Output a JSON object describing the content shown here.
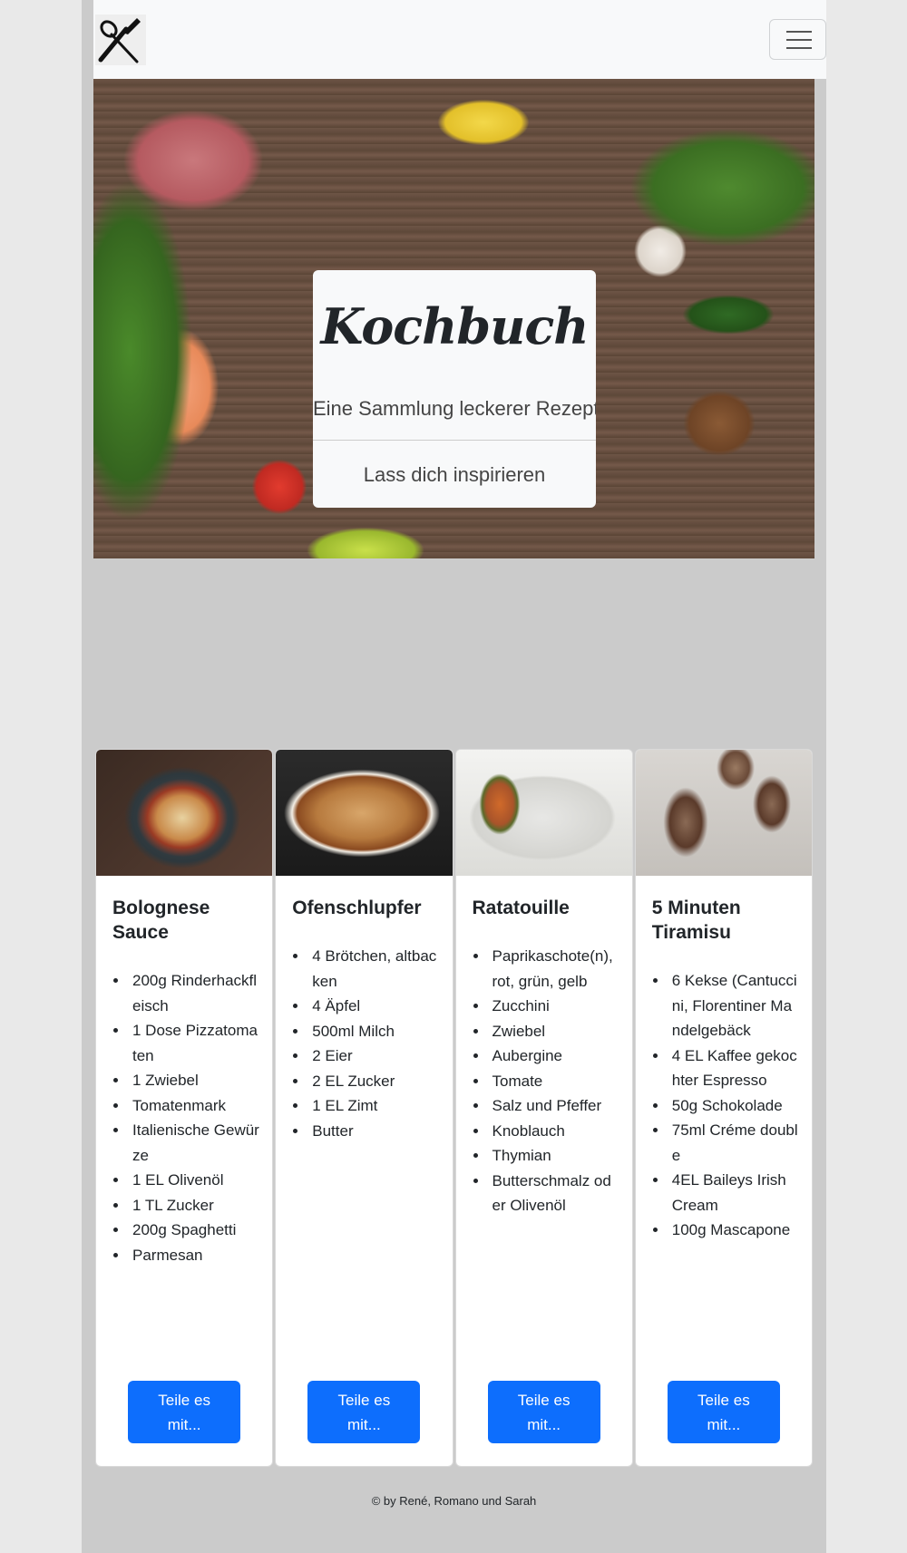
{
  "hero": {
    "title": "Kochbuch",
    "subtitle": "Eine Sammlung leckerer Rezepte",
    "cta": "Lass dich inspirieren"
  },
  "recipes": [
    {
      "title": "Bolognese Sauce",
      "ingredients": [
        "200g Rinderhackfleisch",
        "1 Dose Pizzatomaten",
        "1 Zwiebel",
        "Tomatenmark",
        "Italienische Gewürze",
        "1 EL Olivenöl",
        "1 TL Zucker",
        "200g Spaghetti",
        "Parmesan"
      ],
      "button": "Teile es mit..."
    },
    {
      "title": "Ofenschlupfer",
      "ingredients": [
        "4 Brötchen, altbacken",
        "4 Äpfel",
        "500ml Milch",
        "2 Eier",
        "2 EL Zucker",
        "1 EL Zimt",
        "Butter"
      ],
      "button": "Teile es mit..."
    },
    {
      "title": "Ratatouille",
      "ingredients": [
        "Paprikaschote(n), rot, grün, gelb",
        "Zucchini",
        "Zwiebel",
        "Aubergine",
        "Tomate",
        "Salz und Pfeffer",
        "Knoblauch",
        "Thymian",
        "Butterschmalz oder Olivenöl"
      ],
      "button": "Teile es mit..."
    },
    {
      "title": "5 Minuten Tiramisu",
      "ingredients": [
        "6 Kekse (Cantuccini, Florentiner Mandelgebäck",
        "4 EL Kaffee gekochter Espresso",
        "50g Schokolade",
        "75ml Créme double",
        "4EL Baileys Irish Cream",
        "100g Mascapone"
      ],
      "button": "Teile es mit..."
    }
  ],
  "footer": {
    "text": "© by René, Romano und Sarah"
  },
  "icons": {
    "logo": "knife-spoon-logo-icon",
    "menu": "hamburger-menu-icon"
  },
  "colors": {
    "primary": "#0d6efd",
    "navbar": "#f8f9fa",
    "page_bg": "#cbcbcb"
  }
}
